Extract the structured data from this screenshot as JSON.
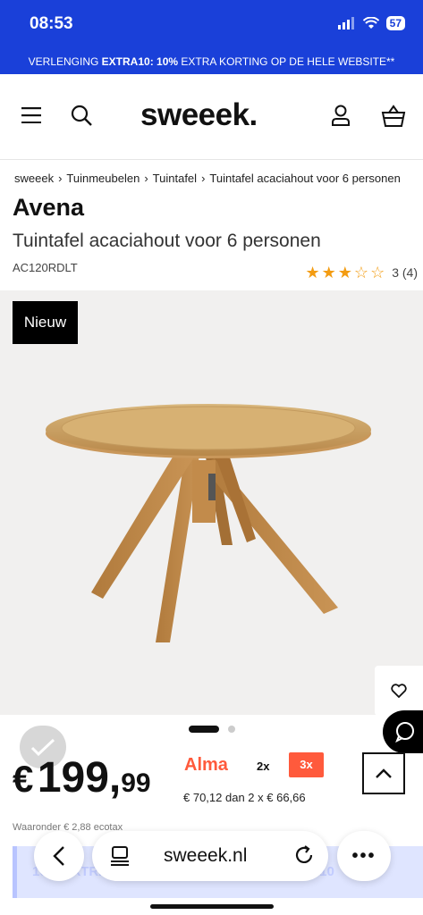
{
  "status_bar": {
    "time": "08:53",
    "battery": "57"
  },
  "promo": {
    "prefix": "VERLENGING ",
    "code": "EXTRA10: 10%",
    "suffix": " EXTRA KORTING OP DE HELE WEBSITE**"
  },
  "header": {
    "logo": "sweeek."
  },
  "breadcrumb": [
    "sweeek",
    "Tuinmeubelen",
    "Tuintafel",
    "Tuintafel acaciahout voor 6 personen"
  ],
  "product": {
    "brand": "Avena",
    "title": "Tuintafel acaciahout voor 6 personen",
    "sku": "AC120RDLT",
    "rating": 3,
    "rating_max": 5,
    "review_count": "3 (4)",
    "badge": "Nieuw",
    "carousel_index": 1,
    "carousel_total": 2
  },
  "price": {
    "currency": "€",
    "integer": "199,",
    "decimal": "99",
    "ecotax": "Waaronder € 2,88 ecotax"
  },
  "alma": {
    "logo": "Alma",
    "opt2": "2x",
    "opt3": "3x",
    "info": "€ 70,12 dan 2 x € 66,66"
  },
  "banner": {
    "text": "10% EXTRA KORTING MET DE CODE EXTRA10"
  },
  "browser": {
    "url": "sweeek.nl"
  },
  "colors": {
    "brand_blue": "#1a40d9",
    "alma_orange": "#ff5a3c",
    "star": "#f39c12"
  }
}
